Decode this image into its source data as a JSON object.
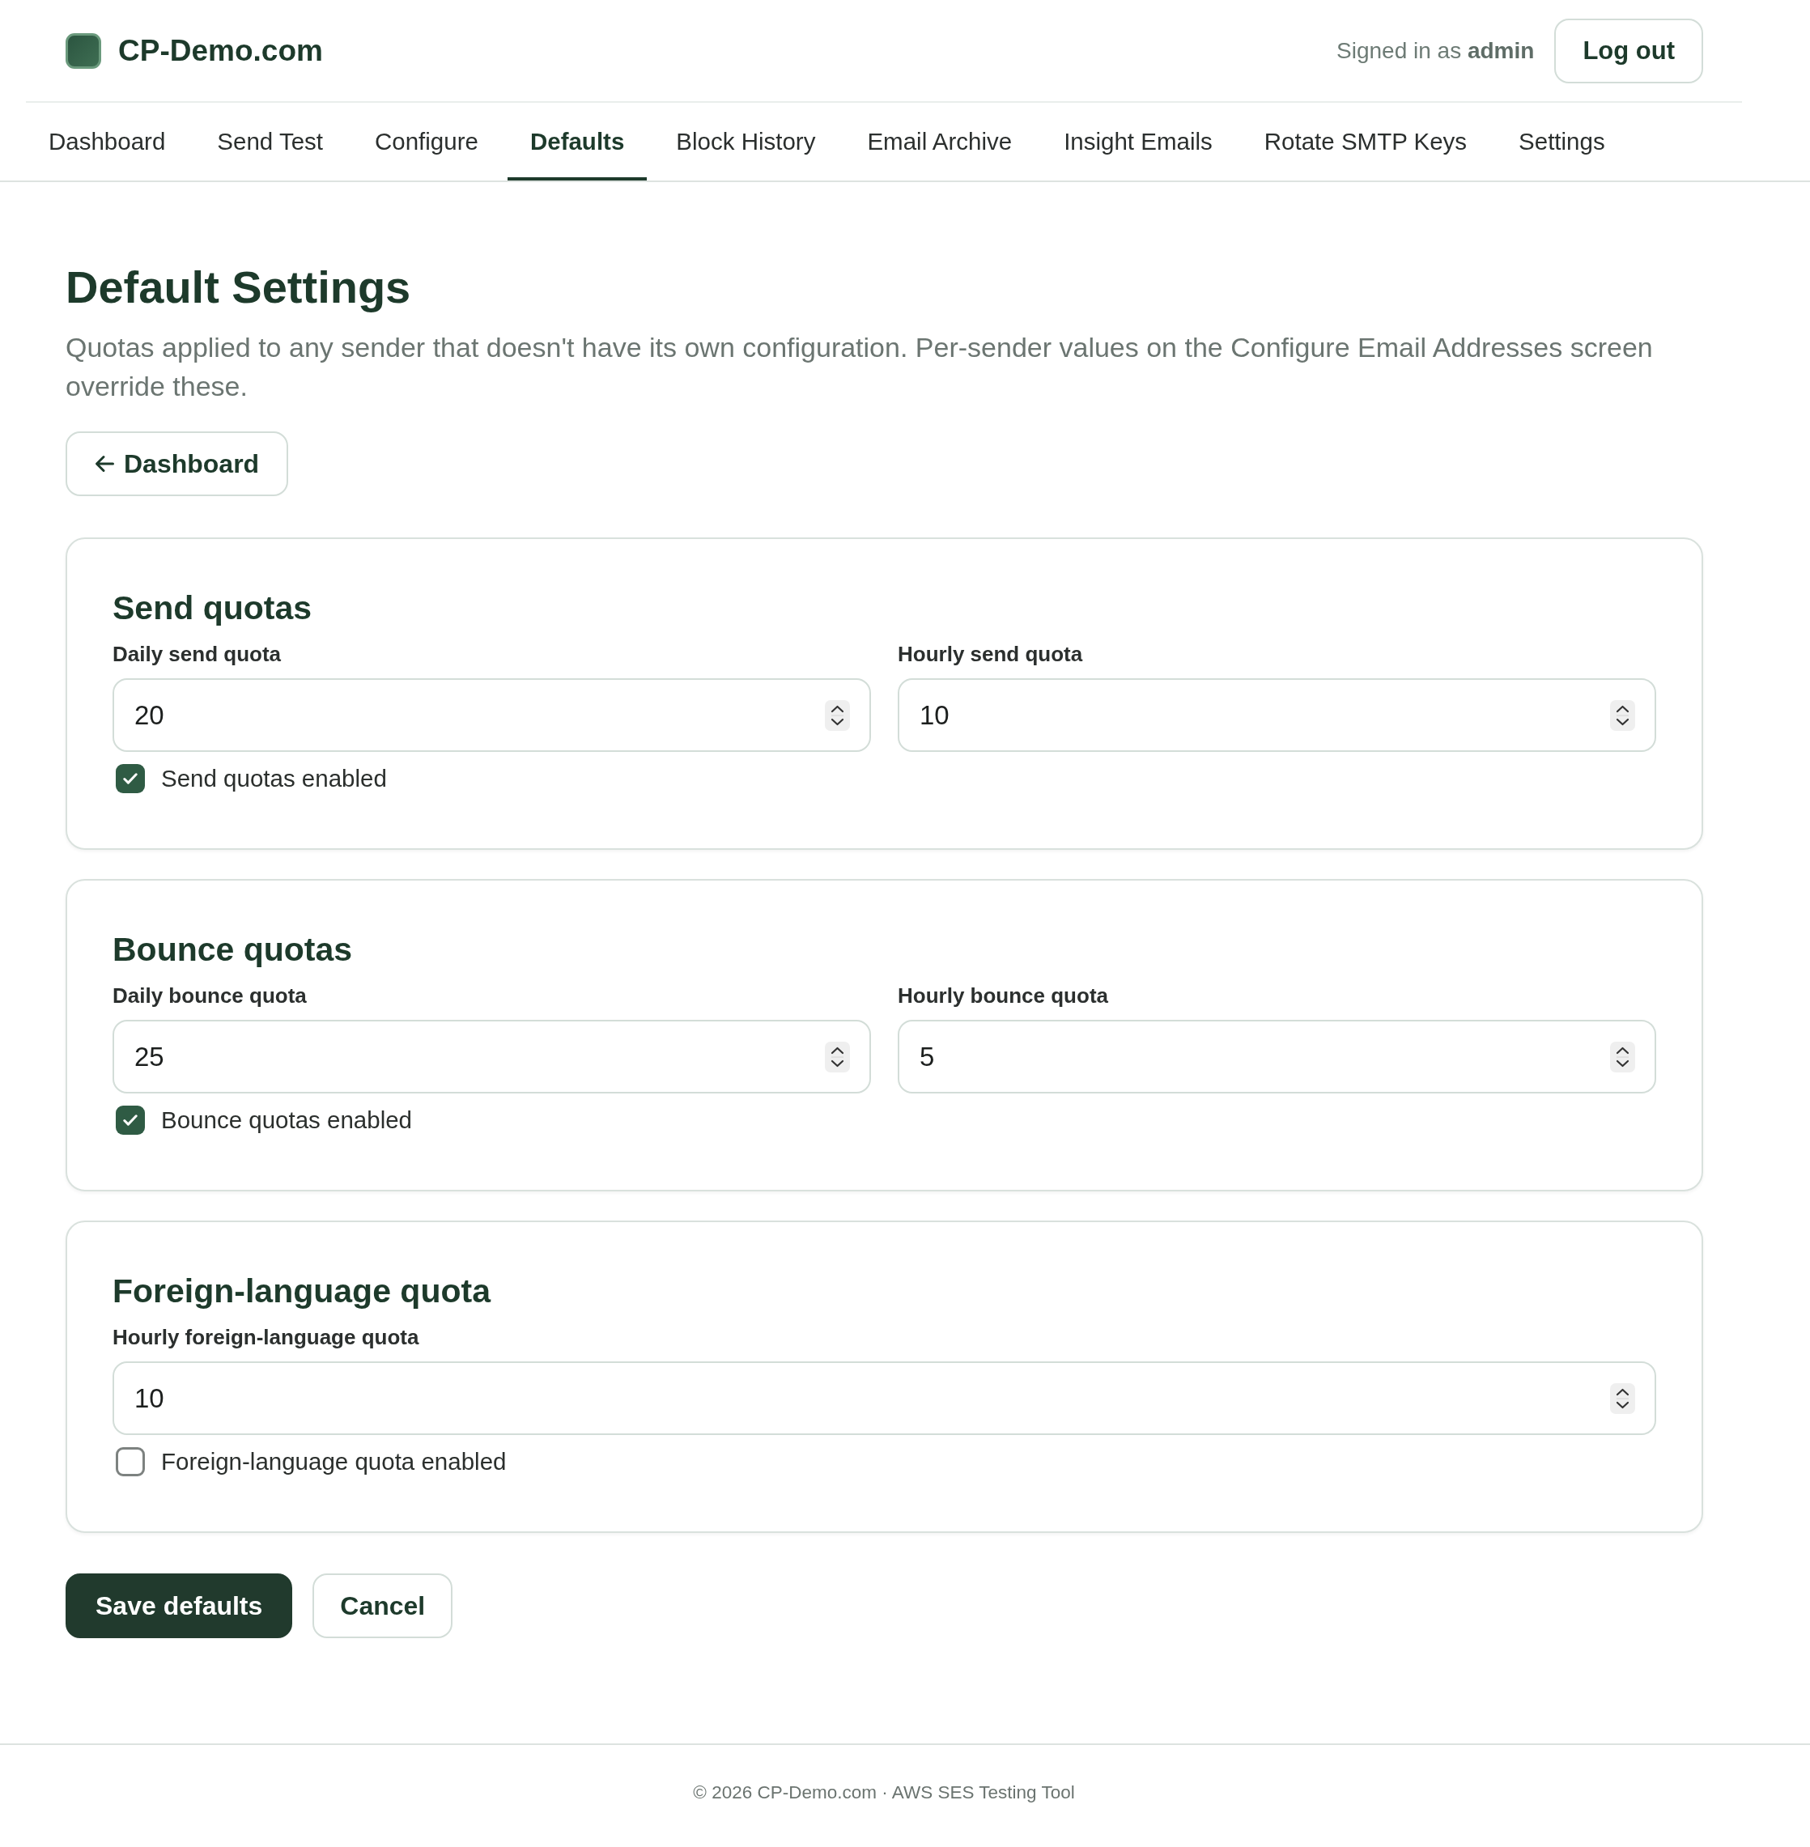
{
  "header": {
    "brand": "CP-Demo.com",
    "signed_in": "Signed in as **admin**",
    "logout": "Log out"
  },
  "nav": [
    {
      "label": "Dashboard",
      "selected": false
    },
    {
      "label": "Send Test",
      "selected": false
    },
    {
      "label": "Configure",
      "selected": false
    },
    {
      "label": "Defaults",
      "selected": true
    },
    {
      "label": "Block History",
      "selected": false
    },
    {
      "label": "Email Archive",
      "selected": false
    },
    {
      "label": "Insight Emails",
      "selected": false
    },
    {
      "label": "Rotate SMTP Keys",
      "selected": false
    },
    {
      "label": "Settings",
      "selected": false
    }
  ],
  "page": {
    "title": "Default Settings",
    "description": "Quotas applied to any sender that doesn't have its own configuration. Per-sender values on the Configure Email Addresses screen override these.",
    "back_button": "Dashboard"
  },
  "sections": [
    {
      "title": "Send quotas",
      "fields": [
        {
          "label": "Daily send quota",
          "value": "20"
        },
        {
          "label": "Hourly send quota",
          "value": "10"
        }
      ],
      "toggle": {
        "label": "Send quotas enabled",
        "checked": true
      }
    },
    {
      "title": "Bounce quotas",
      "fields": [
        {
          "label": "Daily bounce quota",
          "value": "25"
        },
        {
          "label": "Hourly bounce quota",
          "value": "5"
        }
      ],
      "toggle": {
        "label": "Bounce quotas enabled",
        "checked": true
      }
    },
    {
      "title": "Foreign-language quota",
      "fields": [
        {
          "label": "Hourly foreign-language quota",
          "value": "10"
        }
      ],
      "toggle": {
        "label": "Foreign-language quota enabled",
        "checked": false
      }
    }
  ],
  "actions": {
    "save": "Save defaults",
    "cancel": "Cancel"
  },
  "footer": "© 2026 CP-Demo.com · AWS SES Testing Tool"
}
